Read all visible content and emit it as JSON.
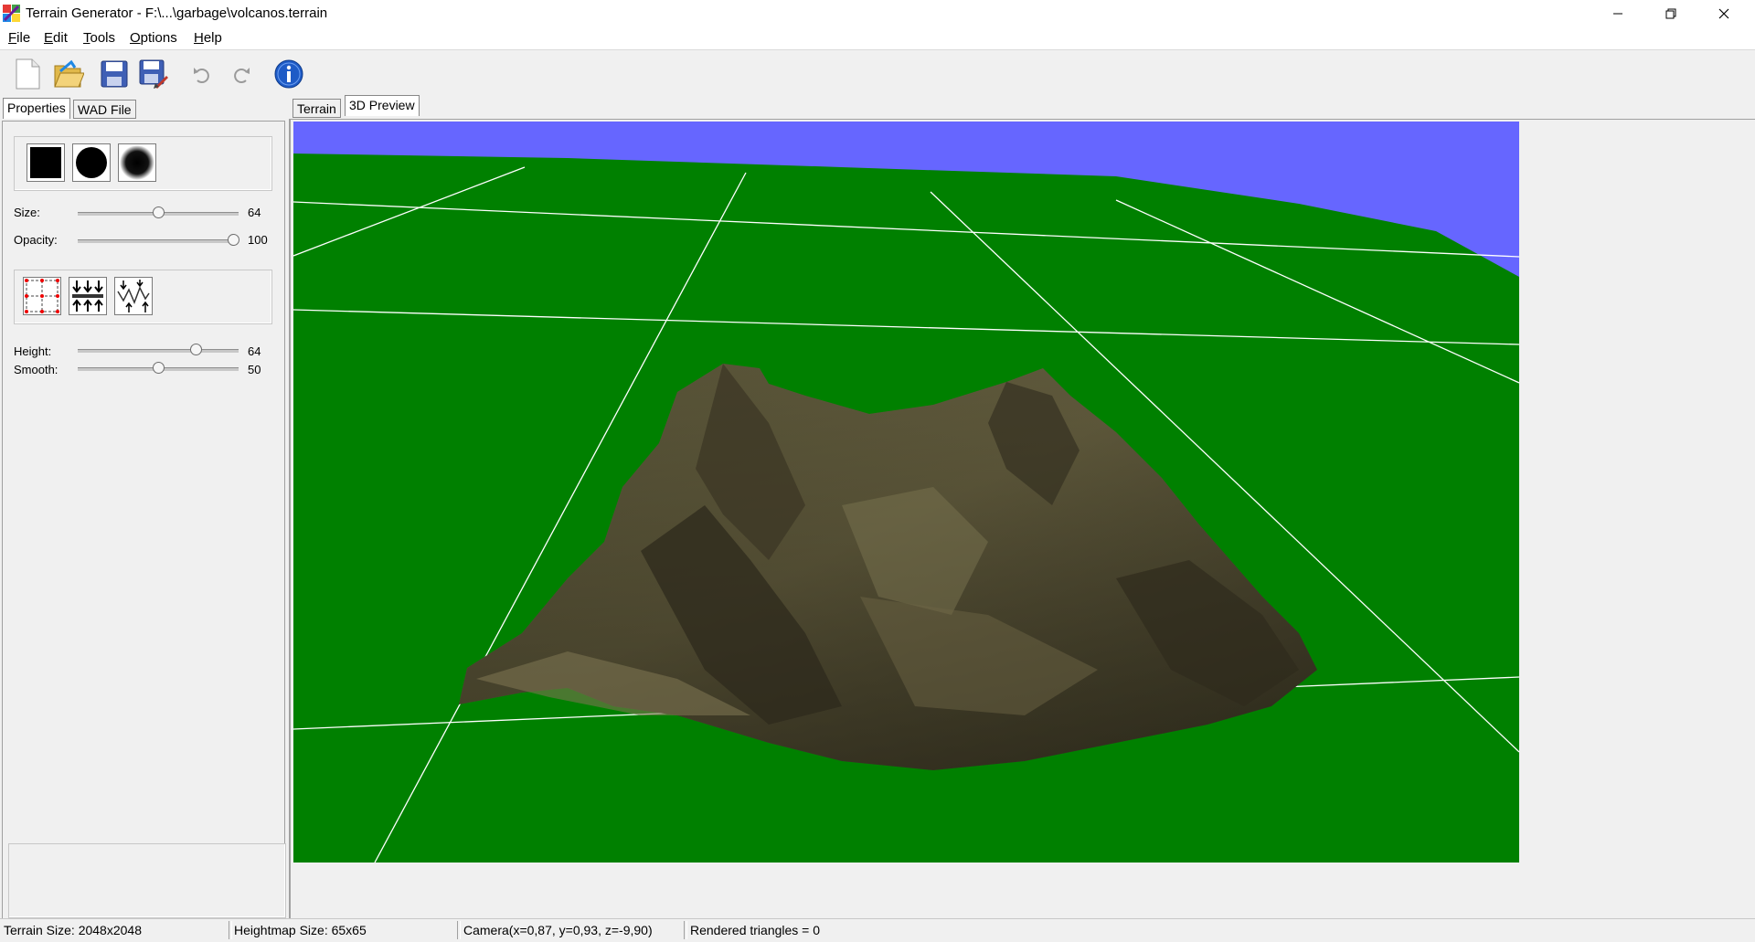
{
  "window": {
    "title": "Terrain Generator - F:\\...\\garbage\\volcanos.terrain"
  },
  "menu": [
    {
      "accel": "F",
      "rest": "ile"
    },
    {
      "accel": "E",
      "rest": "dit"
    },
    {
      "accel": "T",
      "rest": "ools"
    },
    {
      "accel": "O",
      "rest": "ptions"
    },
    {
      "accel": "H",
      "rest": "elp"
    }
  ],
  "toolbar": {
    "icons": [
      "new-file-icon",
      "open-folder-icon",
      "save-icon",
      "save-as-icon",
      "undo-icon",
      "redo-icon",
      "info-icon"
    ]
  },
  "left_tabs": [
    "Properties",
    "WAD File"
  ],
  "brush": {
    "size_label": "Size:",
    "size_value": "64",
    "size_level": 0.5,
    "opacity_label": "Opacity:",
    "opacity_value": "100",
    "opacity_level": 1.0,
    "height_label": "Height:",
    "height_value": "64",
    "height_level": 0.75,
    "smooth_label": "Smooth:",
    "smooth_value": "50",
    "smooth_level": 0.5
  },
  "right_tabs": [
    "Terrain",
    "3D Preview"
  ],
  "viewport": {
    "sky_color": "#6666ff",
    "ground_color": "#008000",
    "grid_color": "#ffffff"
  },
  "status": {
    "terrain_size": "Terrain Size: 2048x2048",
    "heightmap_size": "Heightmap Size: 65x65",
    "camera": "Camera(x=0,87, y=0,93, z=-9,90)",
    "triangles": "Rendered triangles = 0"
  }
}
